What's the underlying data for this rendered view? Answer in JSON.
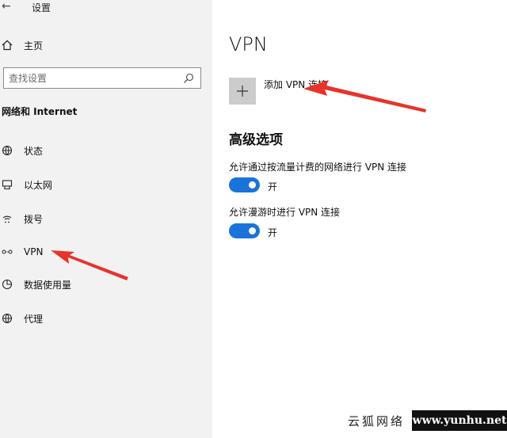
{
  "window": {
    "title": "设置"
  },
  "sidebar": {
    "home_label": "主页",
    "search_placeholder": "查找设置",
    "section_label": "网络和 Internet",
    "items": [
      {
        "label": "状态",
        "icon": "globe-icon"
      },
      {
        "label": "以太网",
        "icon": "ethernet-icon"
      },
      {
        "label": "拨号",
        "icon": "dialup-icon"
      },
      {
        "label": "VPN",
        "icon": "vpn-icon"
      },
      {
        "label": "数据使用量",
        "icon": "data-usage-icon"
      },
      {
        "label": "代理",
        "icon": "proxy-icon"
      }
    ]
  },
  "main": {
    "title": "VPN",
    "add_vpn_label": "添加 VPN 连接",
    "advanced_title": "高级选项",
    "options": [
      {
        "label": "允许通过按流量计费的网络进行 VPN 连接",
        "state": "开",
        "on": true
      },
      {
        "label": "允许漫游时进行 VPN 连接",
        "state": "开",
        "on": true
      }
    ]
  },
  "colors": {
    "accent": "#1a73d9",
    "arrow": "#e8332a"
  },
  "watermark": {
    "left": "云狐网络",
    "right": "www.yunhu.net"
  }
}
